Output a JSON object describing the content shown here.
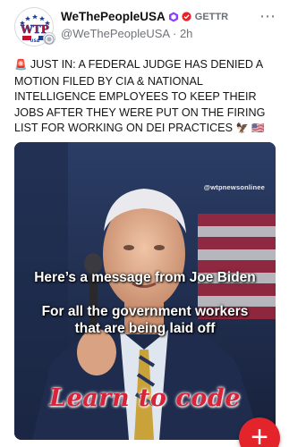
{
  "post": {
    "author_name": "WeThePeopleUSA",
    "platform": "GETTR",
    "handle": "@WeThePeopleUSA",
    "separator": "·",
    "time_ago": "2h",
    "more_icon": "⋯",
    "alert_emoji": "🚨",
    "text": "JUST IN: A FEDERAL JUDGE HAS DENIED A MOTION FILED BY CIA & NATIONAL INTELLIGENCE EMPLOYEES TO KEEP THEIR JOBS AFTER THEY WERE PUT ON THE FIRING LIST FOR WORKING ON DEI PRACTICES",
    "trailing_emojis": "🦅 🇺🇸",
    "avatar_text": "WTP",
    "avatar_sub": "USA"
  },
  "media": {
    "watermark": "@wtpnewsonlinee",
    "caption_line1": "Here’s a message from Joe Biden",
    "caption_line2a": "For all the government workers",
    "caption_line2b": "that are being laid off",
    "caption_script": "Learn to code"
  },
  "fab": {
    "label": "+"
  },
  "colors": {
    "accent": "#e3242b",
    "verified_purple": "#8a3ffc",
    "verified_red": "#e3242b"
  }
}
